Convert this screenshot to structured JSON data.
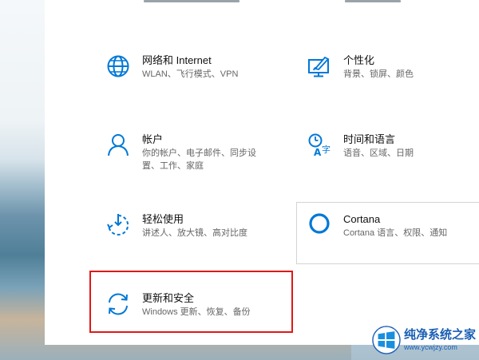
{
  "colors": {
    "accent": "#0078d7",
    "highlight": "#e01818"
  },
  "tiles": [
    {
      "title": "网络和 Internet",
      "desc": "WLAN、飞行模式、VPN",
      "icon": "globe-icon"
    },
    {
      "title": "个性化",
      "desc": "背景、锁屏、颜色",
      "icon": "personalization-icon"
    },
    {
      "title": "帐户",
      "desc": "你的帐户、电子邮件、同步设置、工作、家庭",
      "icon": "account-icon"
    },
    {
      "title": "时间和语言",
      "desc": "语音、区域、日期",
      "icon": "time-language-icon"
    },
    {
      "title": "轻松使用",
      "desc": "讲述人、放大镜、高对比度",
      "icon": "ease-of-access-icon"
    },
    {
      "title": "Cortana",
      "desc": "Cortana 语言、权限、通知",
      "icon": "cortana-icon"
    },
    {
      "title": "更新和安全",
      "desc": "Windows 更新、恢复、备份",
      "icon": "update-security-icon"
    }
  ],
  "watermark": {
    "title": "纯净系统之家",
    "url": "www.ycwjzy.com"
  }
}
